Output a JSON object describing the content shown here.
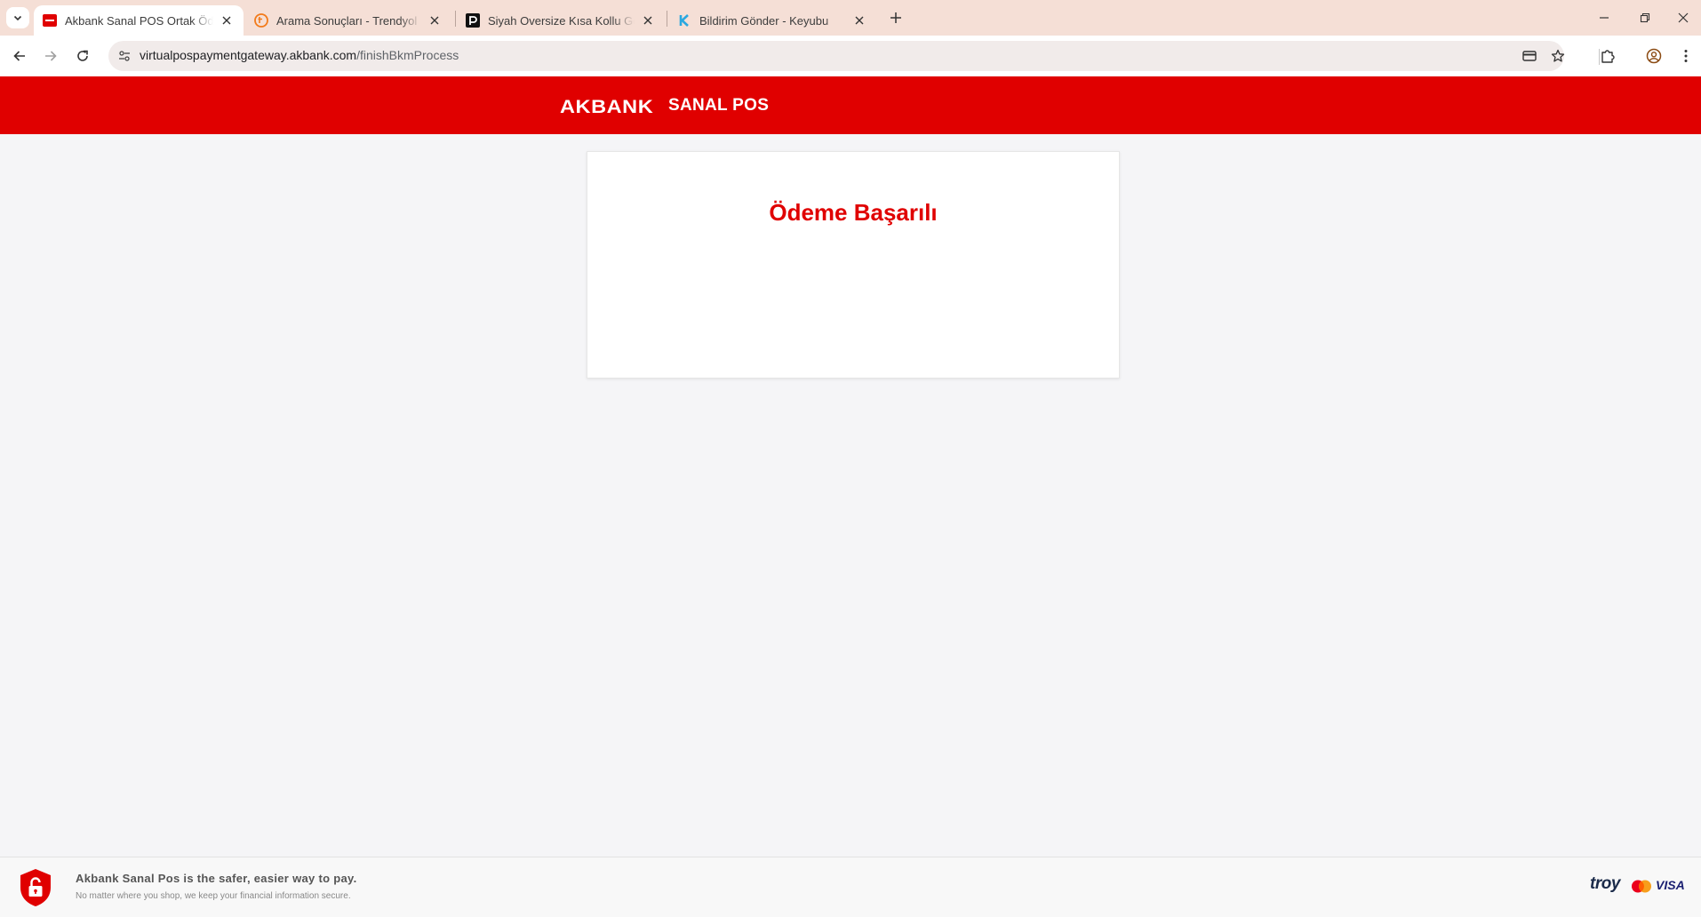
{
  "browser": {
    "tabs": [
      {
        "title": "Akbank Sanal POS Ortak Ödeme",
        "active": true,
        "favicon": "akbank-favicon"
      },
      {
        "title": "Arama Sonuçları - Trendyol",
        "active": false,
        "favicon": "trendyol-favicon"
      },
      {
        "title": "Siyah Oversize Kısa Kollu Gömlek",
        "active": false,
        "favicon": "pierre-cardin-favicon"
      },
      {
        "title": "Bildirim Gönder - Keyubu",
        "active": false,
        "favicon": "keyubu-favicon"
      }
    ],
    "address": {
      "host": "virtualpospaymentgateway.akbank.com",
      "path": "/finishBkmProcess"
    }
  },
  "header": {
    "brand": "AKBANK",
    "product": "SANAL POS"
  },
  "result": {
    "title": "Ödeme Başarılı"
  },
  "footer": {
    "tagline": "Akbank Sanal Pos is the safer, easier way to pay.",
    "subtext": "No matter where you shop, we keep your financial information secure.",
    "troy": "troy",
    "visa": "VISA"
  },
  "colors": {
    "brand_red": "#e00000",
    "tabstrip": "#f5dfd6",
    "page_bg": "#f5f5f7"
  }
}
